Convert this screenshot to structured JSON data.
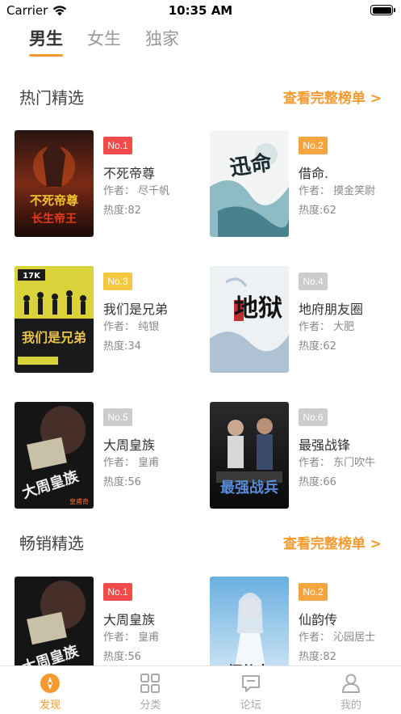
{
  "status_bar": {
    "carrier": "Carrier",
    "time": "10:35 AM"
  },
  "gender_tabs": [
    {
      "label": "男生",
      "active": true
    },
    {
      "label": "女生",
      "active": false
    },
    {
      "label": "独家",
      "active": false
    }
  ],
  "sections": [
    {
      "title": "热门精选",
      "more": "查看完整榜单 >",
      "books": [
        {
          "rank": "No.1",
          "rank_color": "#f24b4b",
          "title": "不死帝尊",
          "author": "作者：  尽千帆",
          "heat": "热度:82",
          "cover_text": "不死帝尊 长生帝王"
        },
        {
          "rank": "No.2",
          "rank_color": "#f7a541",
          "title": "借命.",
          "author": "作者：  摸金笑尉",
          "heat": "热度:62",
          "cover_text": "迅命"
        },
        {
          "rank": "No.3",
          "rank_color": "#f5c842",
          "title": "我们是兄弟",
          "author": "作者：  纯银",
          "heat": "热度:34",
          "cover_text": "我们是兄弟"
        },
        {
          "rank": "No.4",
          "rank_color": "#cccccc",
          "title": "地府朋友圈",
          "author": "作者：  大肥",
          "heat": "热度:62",
          "cover_text": "地狱"
        },
        {
          "rank": "No.5",
          "rank_color": "#cccccc",
          "title": "大周皇族",
          "author": "作者：  皇甫",
          "heat": "热度:56",
          "cover_text": "大周皇族"
        },
        {
          "rank": "No.6",
          "rank_color": "#cccccc",
          "title": "最强战锋",
          "author": "作者：  东门吹牛",
          "heat": "热度:66",
          "cover_text": "最强战兵"
        }
      ]
    },
    {
      "title": "畅销精选",
      "more": "查看完整榜单 >",
      "books": [
        {
          "rank": "No.1",
          "rank_color": "#f24b4b",
          "title": "大周皇族",
          "author": "作者：  皇甫",
          "heat": "热度:56",
          "cover_text": "大周皇族"
        },
        {
          "rank": "No.2",
          "rank_color": "#f7a541",
          "title": "仙韵传",
          "author": "作者：  沁园居士",
          "heat": "热度:82",
          "cover_text": "缥仙女"
        }
      ]
    }
  ],
  "tab_bar": [
    {
      "label": "发现",
      "icon": "discover-icon",
      "active": true
    },
    {
      "label": "分类",
      "icon": "grid-icon",
      "active": false
    },
    {
      "label": "论坛",
      "icon": "chat-icon",
      "active": false
    },
    {
      "label": "我的",
      "icon": "person-icon",
      "active": false
    }
  ],
  "colors": {
    "accent": "#f59a2f"
  }
}
